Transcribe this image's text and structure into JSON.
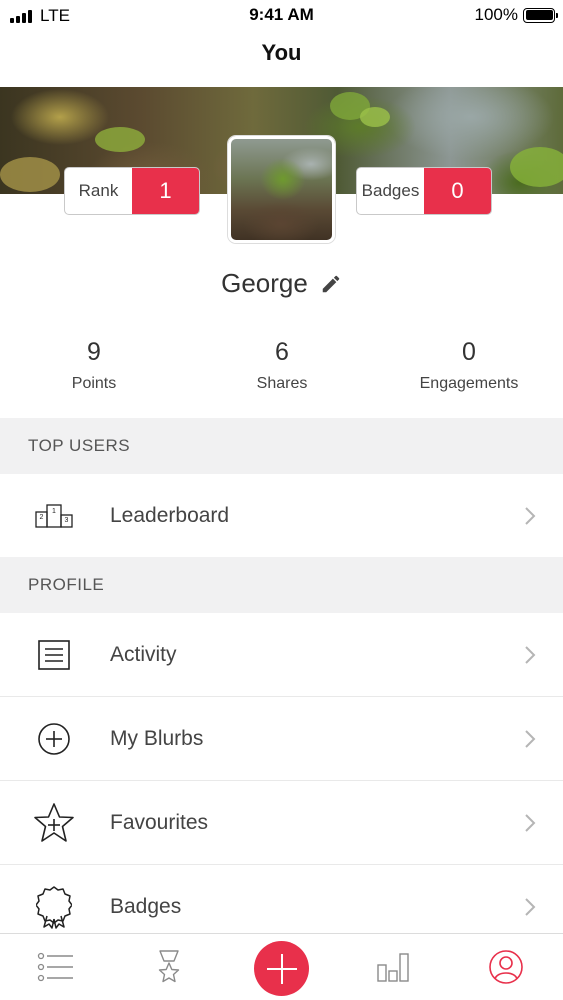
{
  "status_bar": {
    "carrier": "LTE",
    "time": "9:41 AM",
    "battery_percent": "100%"
  },
  "nav": {
    "title": "You"
  },
  "profile": {
    "rank_label": "Rank",
    "rank_value": "1",
    "badges_label": "Badges",
    "badges_value": "0",
    "name": "George"
  },
  "stats": [
    {
      "value": "9",
      "label": "Points"
    },
    {
      "value": "6",
      "label": "Shares"
    },
    {
      "value": "0",
      "label": "Engagements"
    }
  ],
  "sections": {
    "top_users": {
      "header": "TOP USERS",
      "items": [
        {
          "label": "Leaderboard",
          "icon": "podium-icon"
        }
      ]
    },
    "profile": {
      "header": "PROFILE",
      "items": [
        {
          "label": "Activity",
          "icon": "list-box-icon"
        },
        {
          "label": "My Blurbs",
          "icon": "plus-circle-icon"
        },
        {
          "label": "Favourites",
          "icon": "star-plus-icon"
        },
        {
          "label": "Badges",
          "icon": "ribbon-badge-icon"
        }
      ]
    }
  },
  "tab_bar": {
    "items": [
      "feed-list-icon",
      "award-star-icon",
      "add-icon",
      "bar-chart-icon",
      "profile-icon"
    ],
    "accent": "#e8304b"
  },
  "colors": {
    "accent": "#e8304b",
    "section_bg": "#f1f1f2"
  }
}
